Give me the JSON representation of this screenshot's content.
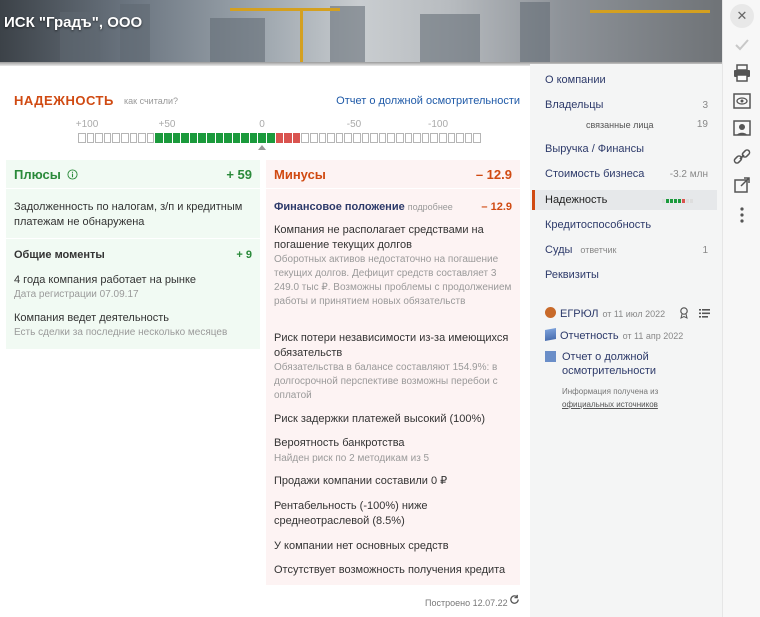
{
  "header": {
    "company_name": "ИСК \"Градъ\", ООО"
  },
  "reliability": {
    "title": "НАДЕЖНОСТЬ",
    "how_link": "как считали?",
    "report_link": "Отчет о должной осмотрительности",
    "scale_labels": [
      "+100",
      "+50",
      "0",
      "-50",
      "-100"
    ],
    "score_indicator": {
      "total_cells": 47,
      "green_cells": 14,
      "red_cells": 3
    }
  },
  "pluses": {
    "title": "Плюсы",
    "value": "+ 59",
    "main_text": "Задолженность по налогам, з/п и кредитным платежам не обнаружена",
    "general": {
      "title": "Общие моменты",
      "value": "+ 9",
      "items": [
        {
          "title": "4 года компания работает на рынке",
          "subtitle": "Дата регистрации 07.09.17"
        },
        {
          "title": "Компания ведет деятельность",
          "subtitle": "Есть сделки за последние несколько месяцев"
        }
      ]
    }
  },
  "minuses": {
    "title": "Минусы",
    "value": "– 12.9",
    "financial": {
      "title": "Финансовое положение",
      "more": "подробнее",
      "value": "– 12.9"
    },
    "items": [
      {
        "title": "Компания не располагает средствами на погашение текущих долгов",
        "subtitle": "Оборотных активов недостаточно на погашение текущих долгов.  Дефицит средств составляет 3 249.0 тыс ₽.  Возможны проблемы с продолжением работы и принятием новых обязательств"
      },
      {
        "title": "Риск потери независимости из-за имеющихся обязательств",
        "subtitle": "Обязательства в балансе составляют 154.9%: в долгосрочной перспективе возможны перебои с оплатой"
      },
      {
        "title": "Риск задержки платежей высокий (100%)",
        "subtitle": ""
      },
      {
        "title": "Вероятность банкротства",
        "subtitle": "Найден риск по 2 методикам из 5"
      },
      {
        "title": "Продажи компании составили 0 ₽",
        "subtitle": ""
      },
      {
        "title": "Рентабельность (-100%) ниже среднеотраслевой (8.5%)",
        "subtitle": ""
      },
      {
        "title": "У компании нет основных средств",
        "subtitle": ""
      },
      {
        "title": "Отсутствует возможность получения кредита",
        "subtitle": ""
      }
    ]
  },
  "built": "Построено 12.07.22",
  "nav": {
    "items": [
      {
        "label": "О компании",
        "count": ""
      },
      {
        "label": "Владельцы",
        "count": "3"
      },
      {
        "label": "связанные лица",
        "count": "19"
      },
      {
        "label": "Выручка / Финансы",
        "count": ""
      },
      {
        "label": "Стоимость бизнеса",
        "count": "-3.2 млн"
      },
      {
        "label": "Надежность",
        "count": ""
      },
      {
        "label": "Кредитоспособность",
        "count": ""
      },
      {
        "label": "Суды",
        "sub": "ответчик",
        "count": "1"
      },
      {
        "label": "Реквизиты",
        "count": ""
      }
    ],
    "docs": [
      {
        "label": "ЕГРЮЛ",
        "date": "от 11 июл 2022"
      },
      {
        "label": "Отчетность",
        "date": "от 11 апр 2022"
      },
      {
        "label": "Отчет о должной осмотрительности",
        "date": ""
      }
    ],
    "info_text": "Информация получена из",
    "info_link": "официальных источников"
  },
  "colors": {
    "accent": "#d04a12",
    "positive": "#1b9a3c",
    "negative": "#d9534f",
    "link": "#2d3a6a"
  }
}
